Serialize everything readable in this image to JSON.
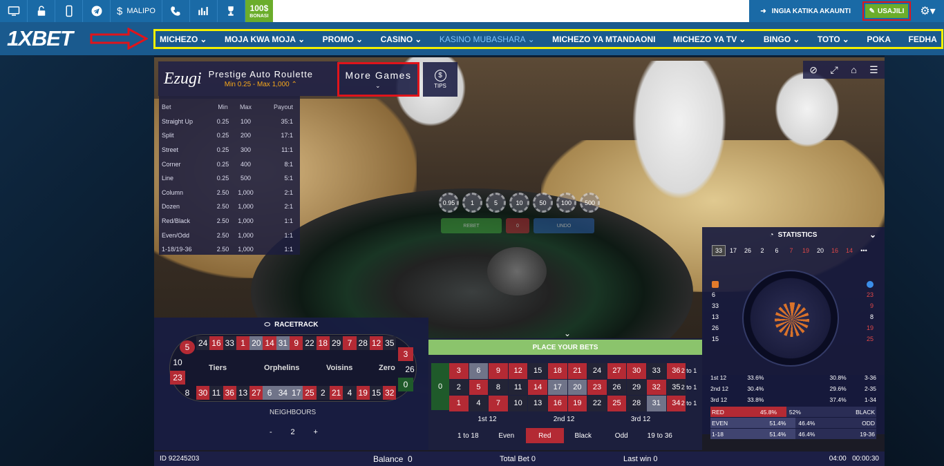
{
  "topbar": {
    "icons": [
      "desktop-icon",
      "lock-icon",
      "mobile-icon",
      "telegram-icon"
    ],
    "payments_label": "MALIPO",
    "bonus_amount": "100$",
    "bonus_label": "BONASI",
    "login_label": "INGIA KATIKA AKAUNTI",
    "register_label": "USAJILI"
  },
  "nav": {
    "logo": "1XBET",
    "items": [
      "MICHEZO",
      "MOJA KWA MOJA",
      "PROMO",
      "CASINO",
      "KASINO MUBASHARA",
      "MICHEZO YA MTANDAONI",
      "MICHEZO YA TV",
      "BINGO",
      "TOTO",
      "POKA",
      "FEDHA"
    ]
  },
  "game": {
    "provider": "Ezugi",
    "title": "Prestige Auto Roulette",
    "limits": "Min 0.25 - Max 1,000",
    "more_games": "More Games",
    "tips": "TIPS",
    "limits_table": {
      "headers": [
        "Bet",
        "Min",
        "Max",
        "Payout"
      ],
      "rows": [
        [
          "Straight Up",
          "0.25",
          "100",
          "35:1"
        ],
        [
          "Split",
          "0.25",
          "200",
          "17:1"
        ],
        [
          "Street",
          "0.25",
          "300",
          "11:1"
        ],
        [
          "Corner",
          "0.25",
          "400",
          "8:1"
        ],
        [
          "Line",
          "0.25",
          "500",
          "5:1"
        ],
        [
          "Column",
          "2.50",
          "1,000",
          "2:1"
        ],
        [
          "Dozen",
          "2.50",
          "1,000",
          "2:1"
        ],
        [
          "Red/Black",
          "2.50",
          "1,000",
          "1:1"
        ],
        [
          "Even/Odd",
          "2.50",
          "1,000",
          "1:1"
        ],
        [
          "1-18/19-36",
          "2.50",
          "1,000",
          "1:1"
        ]
      ]
    },
    "chips": [
      "0.95",
      "1",
      "5",
      "10",
      "50",
      "100",
      "500"
    ],
    "rebet": "REBET",
    "undo": "UNDO",
    "place_bets": "PLACE YOUR BETS",
    "racetrack": {
      "title": "RACETRACK",
      "top": [
        "24",
        "16",
        "33",
        "1",
        "20",
        "14",
        "31",
        "9",
        "22",
        "18",
        "29",
        "7",
        "28",
        "12",
        "35"
      ],
      "bottom": [
        "30",
        "11",
        "36",
        "13",
        "27",
        "6",
        "34",
        "17",
        "25",
        "2",
        "21",
        "4",
        "19",
        "15",
        "32"
      ],
      "left": [
        "5",
        "10",
        "23",
        "8"
      ],
      "right": [
        "3",
        "26",
        "0"
      ],
      "sections": [
        "Tiers",
        "Orphelins",
        "Voisins",
        "Zero"
      ],
      "neighbours_label": "NEIGHBOURS",
      "neighbours_value": "2",
      "minus": "-",
      "plus": "+"
    },
    "board": {
      "zero": "0",
      "rows": [
        [
          "3",
          "6",
          "9",
          "12",
          "15",
          "18",
          "21",
          "24",
          "27",
          "30",
          "33",
          "36"
        ],
        [
          "2",
          "5",
          "8",
          "11",
          "14",
          "17",
          "20",
          "23",
          "26",
          "29",
          "32",
          "35"
        ],
        [
          "1",
          "4",
          "7",
          "10",
          "13",
          "16",
          "19",
          "22",
          "25",
          "28",
          "31",
          "34"
        ]
      ],
      "col_labels": [
        "2 to 1",
        "2 to 1",
        "2 to 1"
      ],
      "dozens": [
        "1st 12",
        "2nd 12",
        "3rd 12"
      ],
      "outside": [
        "1 to 18",
        "Even",
        "Red",
        "Black",
        "Odd",
        "19 to 36"
      ]
    },
    "statistics": {
      "title": "STATISTICS",
      "recent": [
        "33",
        "17",
        "26",
        "2",
        "6",
        "7",
        "19",
        "20",
        "16",
        "14"
      ],
      "hot": [
        "6",
        "33",
        "13",
        "26",
        "15"
      ],
      "cold": [
        "23",
        "9",
        "8",
        "19",
        "25"
      ],
      "dozens": [
        {
          "label": "1st 12",
          "pct": "33.6%",
          "rpct": "30.8%",
          "rlabel": "3-36"
        },
        {
          "label": "2nd 12",
          "pct": "30.4%",
          "rpct": "29.6%",
          "rlabel": "2-35"
        },
        {
          "label": "3rd 12",
          "pct": "33.8%",
          "rpct": "37.4%",
          "rlabel": "1-34"
        }
      ],
      "bars": [
        {
          "left": "RED",
          "p1": "45.8%",
          "p2": "52%",
          "right": "BLACK",
          "fill": 0.458
        },
        {
          "left": "EVEN",
          "p1": "51.4%",
          "p2": "46.4%",
          "right": "ODD",
          "fill": 0.514
        },
        {
          "left": "1-18",
          "p1": "51.4%",
          "p2": "46.4%",
          "right": "19-36",
          "fill": 0.514
        }
      ]
    },
    "footer": {
      "id": "ID 92245203",
      "balance_label": "Balance",
      "balance": "0",
      "total_bet_label": "Total Bet",
      "total_bet": "0",
      "last_win_label": "Last win",
      "last_win": "0",
      "time1": "04:00",
      "time2": "00:00:30"
    }
  },
  "colors": {
    "brand": "#1a6aa6",
    "green": "#6bad2b",
    "red_highlight": "#e0141b",
    "yellow_highlight": "#f4f000",
    "roulette_red": "#b42a34"
  }
}
